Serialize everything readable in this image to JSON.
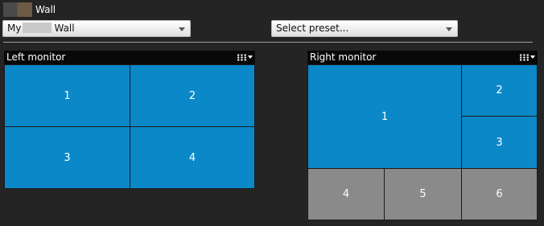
{
  "header": {
    "title": "Wall",
    "thumbnail_icon": "wall-thumbnail"
  },
  "toolbar": {
    "wall_select": {
      "value_prefix": "My",
      "value_suffix": "Wall"
    },
    "preset_select": {
      "placeholder": "Select preset..."
    }
  },
  "monitors": {
    "left": {
      "title": "Left monitor",
      "layout_icon": "grid-menu-icon",
      "tiles": [
        {
          "label": "1",
          "state": "active"
        },
        {
          "label": "2",
          "state": "active"
        },
        {
          "label": "3",
          "state": "active"
        },
        {
          "label": "4",
          "state": "active"
        }
      ]
    },
    "right": {
      "title": "Right monitor",
      "layout_icon": "grid-menu-icon",
      "tiles": [
        {
          "label": "1",
          "state": "active"
        },
        {
          "label": "2",
          "state": "active"
        },
        {
          "label": "3",
          "state": "active"
        },
        {
          "label": "4",
          "state": "empty"
        },
        {
          "label": "5",
          "state": "empty"
        },
        {
          "label": "6",
          "state": "empty"
        }
      ]
    }
  },
  "colors": {
    "background": "#242424",
    "active_tile": "#0a88c8",
    "empty_tile": "#8a8a8a",
    "header_bar": "#080808"
  }
}
